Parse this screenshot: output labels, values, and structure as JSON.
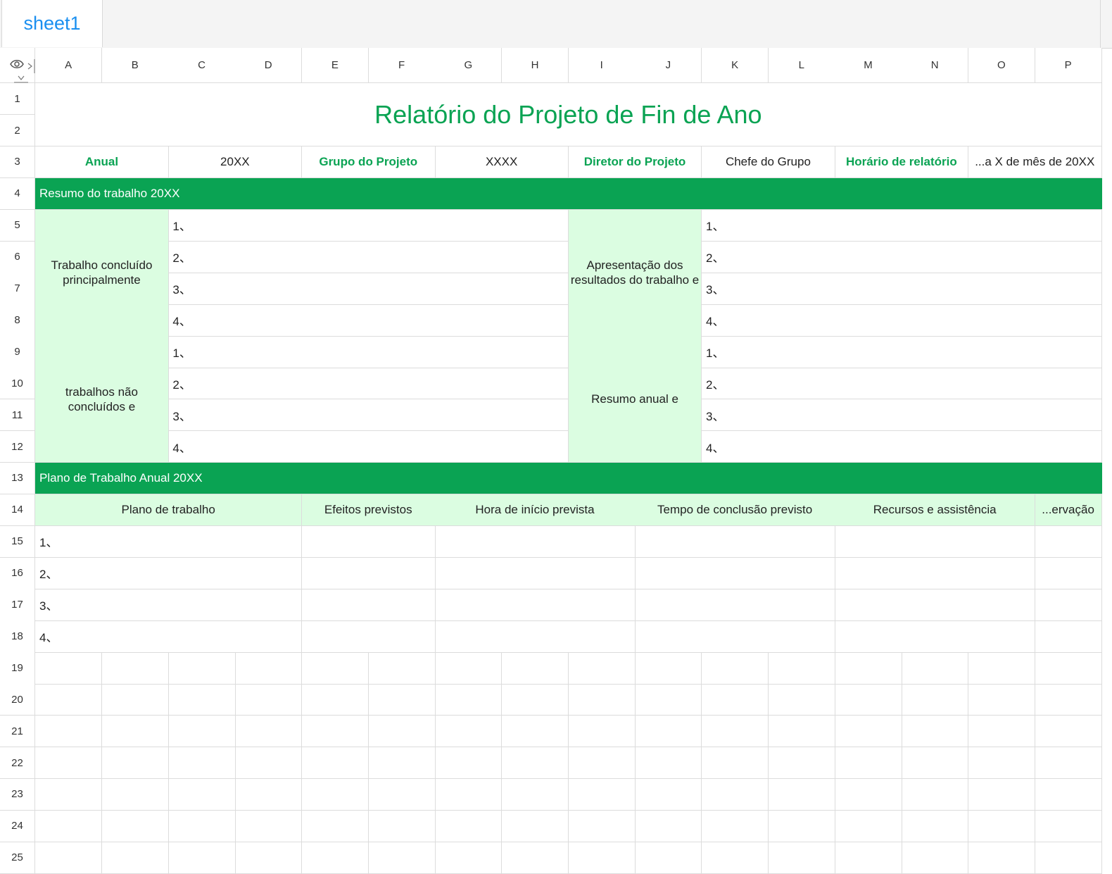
{
  "tabs": [
    "sheet1"
  ],
  "columns": [
    "A",
    "B",
    "C",
    "D",
    "E",
    "F",
    "G",
    "H",
    "I",
    "J",
    "K",
    "L",
    "M",
    "N",
    "O",
    "P"
  ],
  "rows": [
    "1",
    "2",
    "3",
    "4",
    "5",
    "6",
    "7",
    "8",
    "9",
    "10",
    "11",
    "12",
    "13",
    "14",
    "15",
    "16",
    "17",
    "18",
    "19",
    "20",
    "21",
    "22",
    "23",
    "24",
    "25"
  ],
  "title": "Relatório do Projeto de Fin de Ano",
  "info_row": {
    "annual_label": "Anual",
    "annual_value": "20XX",
    "group_label": "Grupo do Projeto",
    "group_value": "XXXX",
    "director_label": "Diretor do Projeto",
    "director_value": "Chefe do Grupo",
    "report_time_label": "Horário de relatório",
    "report_time_value": "...a X de mês de 20XX"
  },
  "summary_band": "Resumo do trabalho 20XX",
  "completed_label": "Trabalho concluído principalmente",
  "results_label": "Apresentação dos resultados do trabalho e",
  "unfinished_label": "trabalhos não concluídos e",
  "annual_summary_label": "Resumo anual e",
  "numbered_items": [
    "1、",
    "2、",
    "3、",
    "4、"
  ],
  "plan_band": "Plano de Trabalho Anual 20XX",
  "plan_headers": {
    "plan": "Plano de trabalho",
    "effects": "Efeitos previstos",
    "start": "Hora de início prevista",
    "completion": "Tempo de conclusão previsto",
    "resources": "Recursos e assistência",
    "observation": "...ervação"
  },
  "colors": {
    "accent_green": "#0aa353",
    "light_green": "#dbfde1",
    "tab_blue": "#1a8ff0"
  }
}
